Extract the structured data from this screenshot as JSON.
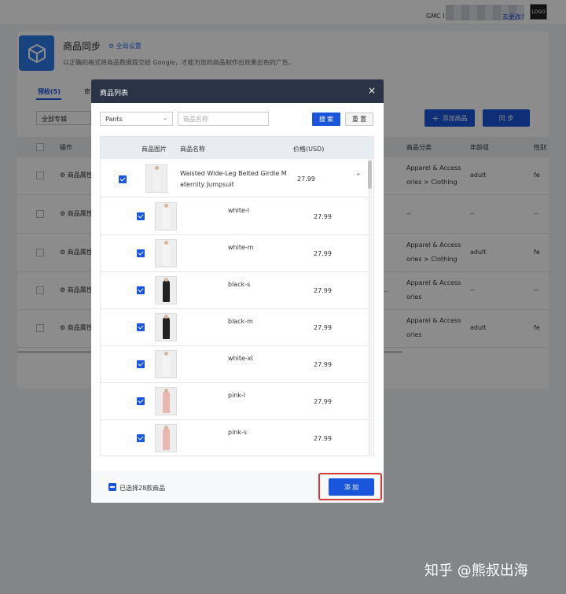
{
  "header": {
    "gmc_label": "GMC I",
    "change_link": "去更改?",
    "logo_text": "LOGO"
  },
  "app": {
    "title": "商品同步",
    "global_settings": "全局设置",
    "description": "以正确的格式将商品数据提交给 Google，才能为您的商品制作出效果出色的广告。"
  },
  "tabs": {
    "precheck": "预检(5)",
    "second": "审"
  },
  "toolbar": {
    "collection_select": "全部专辑",
    "add_product": "添加商品",
    "sync": "同 步"
  },
  "bg_table": {
    "headers": {
      "operation": "操作",
      "category": "商品分类",
      "age": "年龄组",
      "gender": "性别"
    },
    "rows": [
      {
        "op": "商品属性",
        "cat1": "Apparel & Access",
        "cat2": "ories > Clothing",
        "age": "adult",
        "gender": "fe"
      },
      {
        "op": "商品属性",
        "catc": "--",
        "age": "--",
        "gender": "--"
      },
      {
        "op": "商品属性",
        "cat1": "Apparel & Access",
        "cat2": "ories > Clothing",
        "age": "adult",
        "gender": "fe"
      },
      {
        "op": "商品属性",
        "cat1": "Apparel & Access",
        "cat2": "ories",
        "age": "--",
        "gender": "--",
        "dots": "..."
      },
      {
        "op": "商品属性",
        "cat1": "Apparel & Access",
        "cat2": "ories",
        "age": "adult",
        "gender": "fe"
      }
    ]
  },
  "modal": {
    "title": "商品列表",
    "close": "×",
    "filter": {
      "selected_type": "Pants",
      "name_placeholder": "商品名称",
      "search": "搜 索",
      "reset": "重 置"
    },
    "table": {
      "headers": {
        "image": "商品图片",
        "name": "商品名称",
        "price": "价格(USD)"
      },
      "parent": {
        "name_line1": "Waisted Wide-Leg Belted Girdle M",
        "name_line2": "aternity Jumpsuit",
        "price": "27.99",
        "color": "#f1f1f1"
      },
      "variants": [
        {
          "name": "white-l",
          "price": "27.99",
          "color": "#f4f4f4"
        },
        {
          "name": "white-m",
          "price": "27.99",
          "color": "#f4f4f4"
        },
        {
          "name": "black-s",
          "price": "27.99",
          "color": "#222222"
        },
        {
          "name": "black-m",
          "price": "27.99",
          "color": "#222222"
        },
        {
          "name": "white-xl",
          "price": "27.99",
          "color": "#f4f4f4"
        },
        {
          "name": "pink-l",
          "price": "27.99",
          "color": "#e9b7b3"
        },
        {
          "name": "pink-s",
          "price": "27.99",
          "color": "#e9b7b3"
        }
      ]
    },
    "footer": {
      "selected_text": "已选择28款商品",
      "add": "添 加"
    }
  },
  "watermark": "知乎 @熊叔出海",
  "colors": {
    "primary": "#1a56db",
    "modal_header": "#2b3446",
    "highlight": "#d43a3a",
    "app_icon": "#2f7be8"
  }
}
